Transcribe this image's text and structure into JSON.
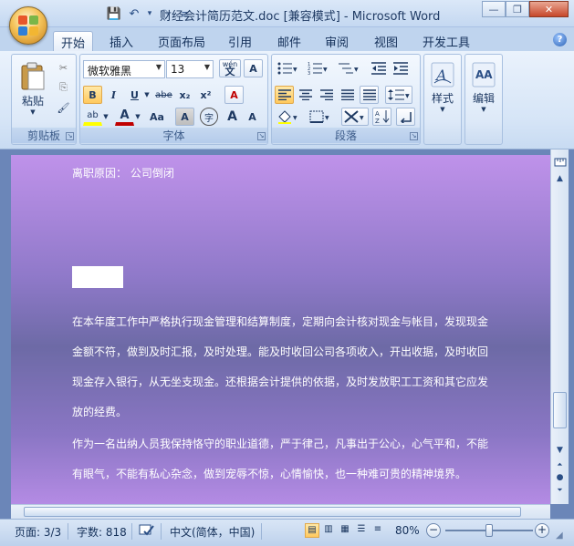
{
  "window": {
    "title": "财经会计简历范文.doc [兼容模式] - Microsoft Word",
    "minimize": "—",
    "restore": "❐",
    "close": "✕"
  },
  "qat": {
    "save": "💾",
    "undo": "↶",
    "undo_drop": "▾",
    "redo": "↷",
    "customize": "≡"
  },
  "tabs": [
    "开始",
    "插入",
    "页面布局",
    "引用",
    "邮件",
    "审阅",
    "视图",
    "开发工具"
  ],
  "help": "?",
  "ribbon": {
    "clipboard": {
      "label": "剪贴板",
      "paste": "粘贴",
      "cut": "✂",
      "copy": "⎘",
      "format_painter": "🖌"
    },
    "font": {
      "label": "字体",
      "font_name": "微软雅黑",
      "font_size": "13",
      "phonetic": "wén",
      "char_border": "A",
      "bold": "B",
      "italic": "I",
      "underline": "U",
      "strike": "abe",
      "subscript": "x₂",
      "superscript": "x²",
      "clear": "A",
      "highlight": "ab",
      "font_color": "A",
      "change_case": "Aa",
      "char_shading": "A",
      "enclose": "字",
      "grow": "A",
      "shrink": "A"
    },
    "paragraph": {
      "label": "段落"
    },
    "styles": {
      "label": "样式"
    },
    "editing": {
      "label": "编辑"
    }
  },
  "document": {
    "line1": "离职原因：  公司倒闭",
    "line2": "在本年度工作中严格执行现金管理和结算制度，定期向会计核对现金与帐目，发现现金",
    "line3": "金额不符，做到及时汇报，及时处理。能及时收回公司各项收入，开出收据，及时收回",
    "line4": "现金存入银行，从无坐支现金。还根据会计提供的依据，及时发放职工工资和其它应发",
    "line5": "放的经费。",
    "line6": "作为一名出纳人员我保持恪守的职业道德，严于律己，凡事出于公心，心气平和，不能",
    "line7": "有眼气，不能有私心杂念，做到宠辱不惊，心情愉快，也一种难可贵的精神境界。"
  },
  "status": {
    "page": "页面: 3/3",
    "words": "字数: 818",
    "language": "中文(简体，中国)",
    "zoom": "80%",
    "zoom_fraction": 0.5
  },
  "colors": {
    "accent": "#c00000",
    "highlight": "#ffff00"
  }
}
